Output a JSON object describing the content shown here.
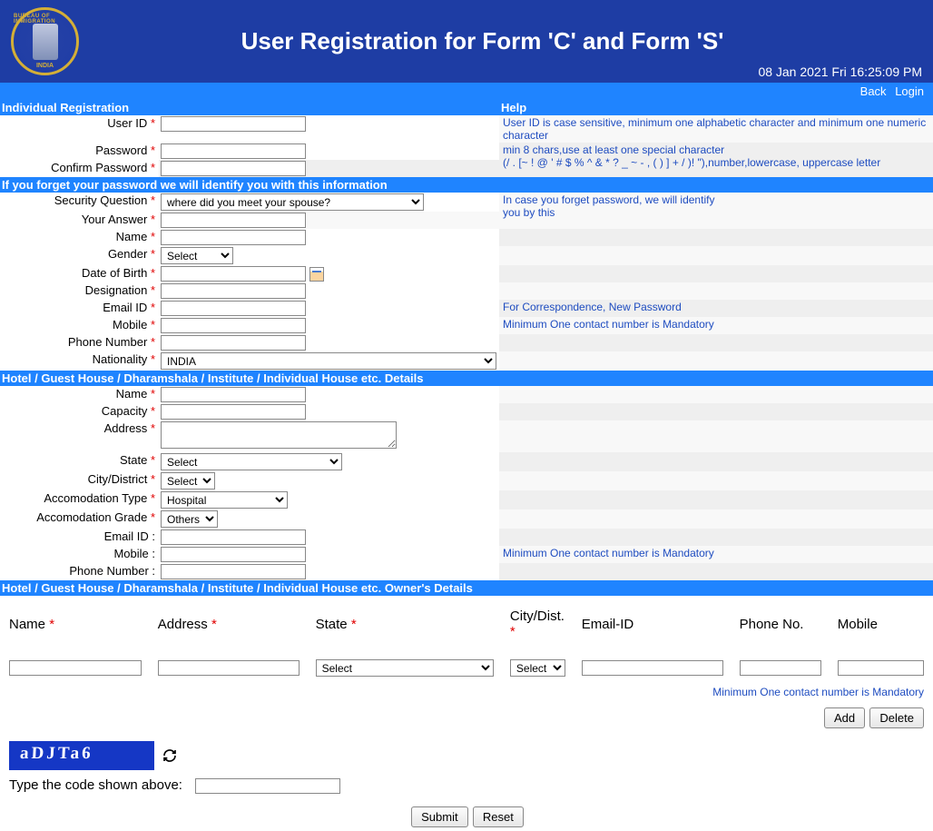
{
  "header": {
    "title": "User Registration for Form 'C' and Form 'S'",
    "timestamp": "08 Jan 2021 Fri 16:25:09 PM",
    "emblem_top": "BUREAU OF IMMIGRATION",
    "emblem_bottom": "INDIA"
  },
  "breadcrumb": {
    "back": "Back",
    "login": "Login"
  },
  "sections": {
    "individual": "Individual Registration",
    "help": "Help",
    "forgot": "If you forget your password we will identify you with this information",
    "hotel": "Hotel / Guest House / Dharamshala / Institute / Individual House etc. Details",
    "owner": "Hotel / Guest House / Dharamshala / Institute / Individual House etc.  Owner's Details"
  },
  "labels": {
    "userid": "User ID",
    "password": "Password",
    "confirm": "Confirm Password",
    "secq": "Security Question",
    "answer": "Your Answer",
    "name": "Name",
    "gender": "Gender",
    "dob": "Date of Birth",
    "designation": "Designation",
    "email": "Email ID",
    "mobile": "Mobile",
    "phone": "Phone Number",
    "nationality": "Nationality",
    "capacity": "Capacity",
    "address": "Address",
    "state": "State",
    "city": "City/District",
    "acctype": "Accomodation Type",
    "accgrade": "Accomodation Grade",
    "emailid2": "Email ID :",
    "mobile2": "Mobile :",
    "phone2": "Phone Number :"
  },
  "help": {
    "userid": "User ID is case sensitive, minimum one alphabetic character and minimum one numeric character",
    "password1": "min 8 chars,use at least one special character",
    "password2": "(/ . [~ ! @ ' # $ % ^ & * ? _ ~ - , ( ) ] + / )! \"),number,lowercase, uppercase letter",
    "secq1": " In case you forget password, we will identify",
    "secq2": "you by this",
    "email": "For Correspondence, New Password",
    "mobile": "Minimum One contact number is Mandatory",
    "owner_contact": "Minimum One contact number is Mandatory"
  },
  "selects": {
    "secq": "where did you meet your spouse?",
    "gender": "Select",
    "nationality": "INDIA",
    "state": "Select",
    "city": "Select",
    "acctype": "Hospital",
    "accgrade": "Others",
    "owner_state": "Select",
    "owner_city": "Select"
  },
  "owner_headers": {
    "name": "Name",
    "address": "Address",
    "state": "State",
    "city": "City/Dist.",
    "email": "Email-ID",
    "phone": "Phone No.",
    "mobile": "Mobile"
  },
  "buttons": {
    "add": "Add",
    "delete": "Delete",
    "submit": "Submit",
    "reset": "Reset"
  },
  "captcha": {
    "text": "aDJTa6",
    "label": "Type the code shown above:"
  }
}
